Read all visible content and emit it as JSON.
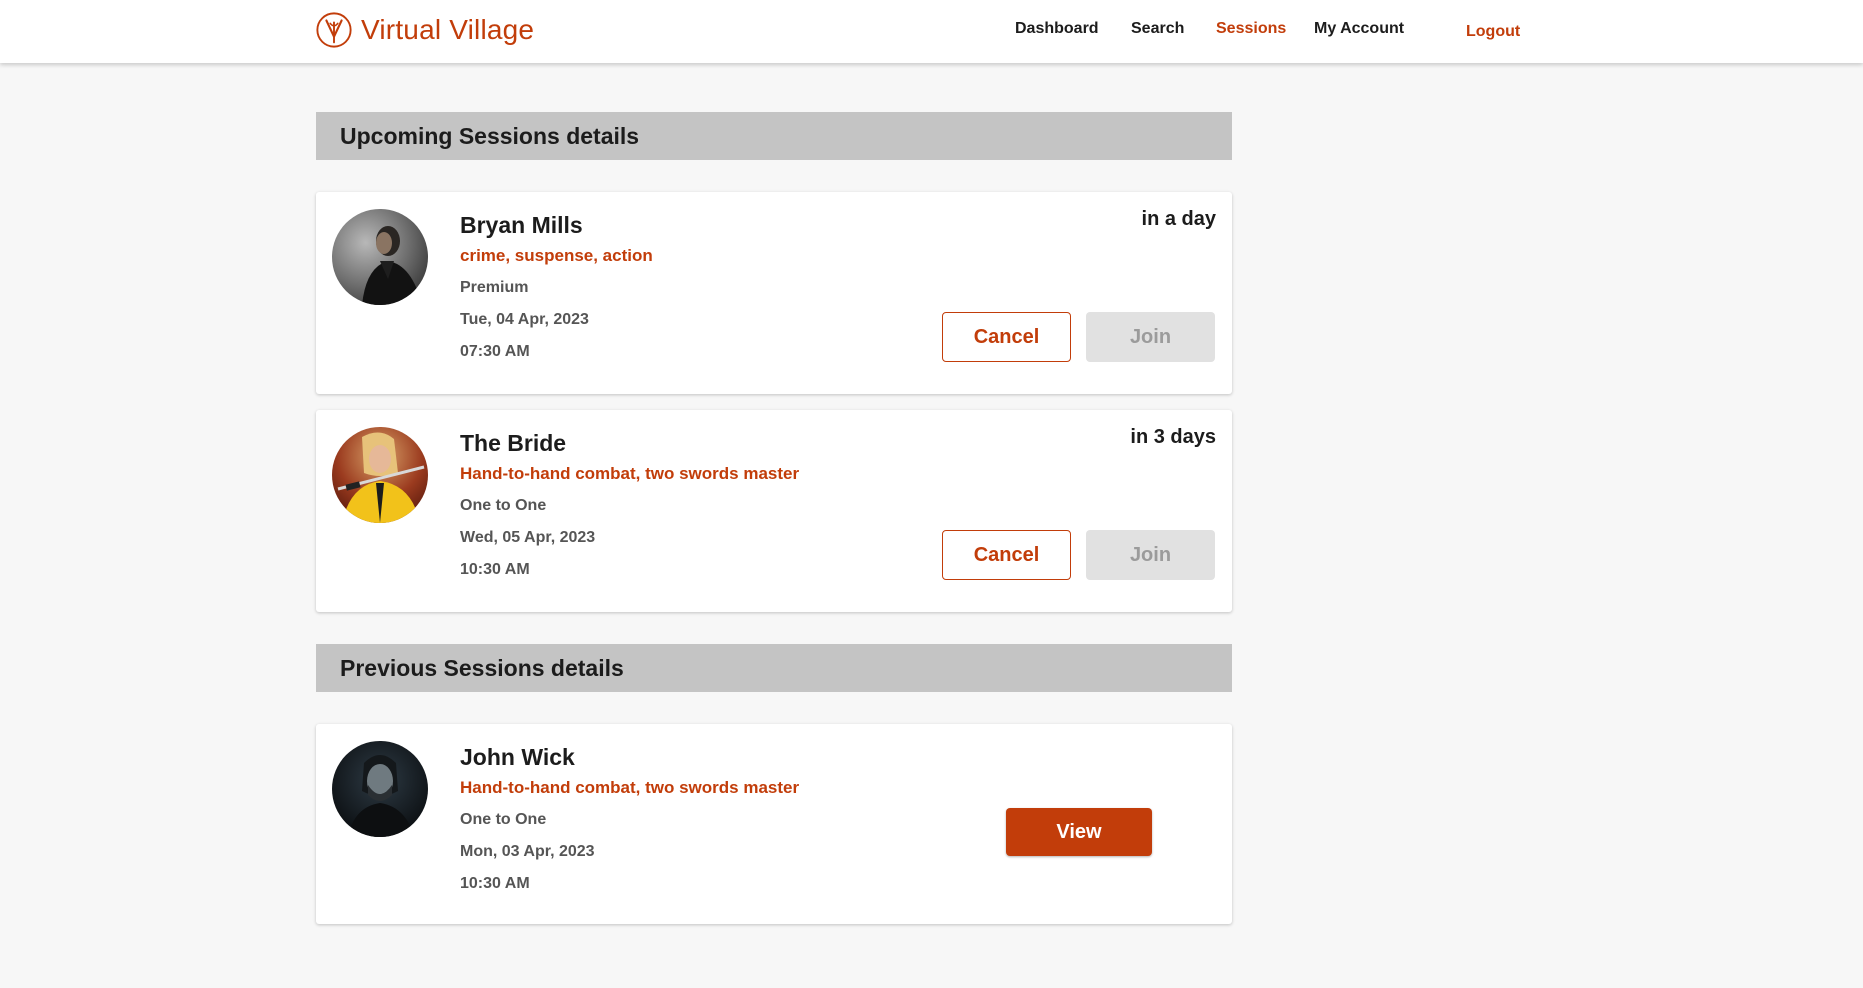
{
  "header": {
    "brand": "Virtual Village",
    "nav": [
      {
        "label": "Dashboard",
        "active": false
      },
      {
        "label": "Search",
        "active": false
      },
      {
        "label": "Sessions",
        "active": true
      },
      {
        "label": "My Account",
        "active": false
      }
    ],
    "logout": "Logout"
  },
  "upcoming": {
    "title": "Upcoming Sessions details",
    "sessions": [
      {
        "name": "Bryan Mills",
        "tags": "crime, suspense, action",
        "type": "Premium",
        "date": "Tue, 04 Apr, 2023",
        "time": "07:30 AM",
        "when": "in a day",
        "cancel_label": "Cancel",
        "join_label": "Join"
      },
      {
        "name": "The Bride",
        "tags": "Hand-to-hand combat, two swords master",
        "type": "One to One",
        "date": "Wed, 05 Apr, 2023",
        "time": "10:30 AM",
        "when": "in 3 days",
        "cancel_label": "Cancel",
        "join_label": "Join"
      }
    ]
  },
  "previous": {
    "title": "Previous Sessions details",
    "sessions": [
      {
        "name": "John Wick",
        "tags": "Hand-to-hand combat, two swords master",
        "type": "One to One",
        "date": "Mon, 03 Apr, 2023",
        "time": "10:30 AM",
        "view_label": "View"
      }
    ]
  },
  "colors": {
    "accent": "#c23d0a",
    "section_bg": "#c4c4c4",
    "page_bg": "#f7f7f7",
    "join_disabled_bg": "#e1e1e1"
  },
  "icons": {
    "brand_logo": "village-logo-icon"
  }
}
